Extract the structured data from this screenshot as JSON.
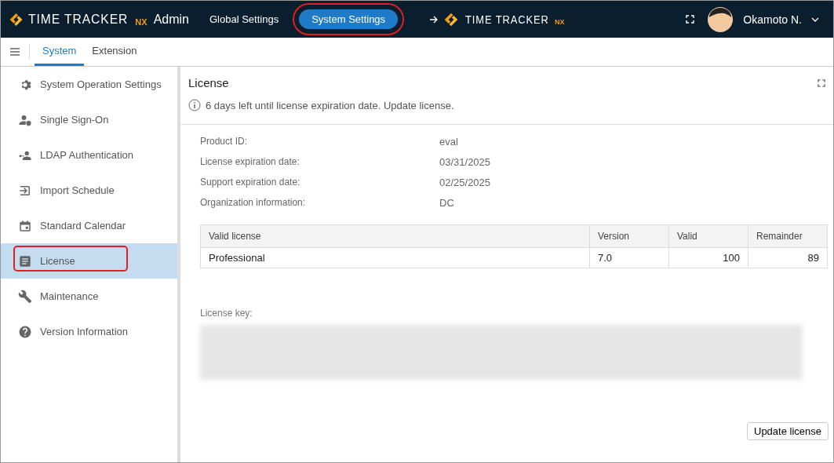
{
  "header": {
    "brand": {
      "name": "TIME TRACKER",
      "suffix": "NX",
      "label": "Admin"
    },
    "nav": [
      {
        "label": "Global Settings",
        "selected": false,
        "highlighted": false
      },
      {
        "label": "System Settings",
        "selected": true,
        "highlighted": true
      }
    ],
    "link_logo": {
      "name": "TIME TRACKER",
      "suffix": "NX"
    },
    "user": {
      "name": "Okamoto N."
    }
  },
  "tabs": [
    {
      "label": "System",
      "selected": true
    },
    {
      "label": "Extension",
      "selected": false
    }
  ],
  "sidebar": {
    "items": [
      {
        "label": "System Operation Settings",
        "selected": false,
        "highlighted": false
      },
      {
        "label": "Single Sign-On",
        "selected": false,
        "highlighted": false
      },
      {
        "label": "LDAP Authentication",
        "selected": false,
        "highlighted": false
      },
      {
        "label": "Import Schedule",
        "selected": false,
        "highlighted": false
      },
      {
        "label": "Standard Calendar",
        "selected": false,
        "highlighted": false
      },
      {
        "label": "License",
        "selected": true,
        "highlighted": true
      },
      {
        "label": "Maintenance",
        "selected": false,
        "highlighted": false
      },
      {
        "label": "Version Information",
        "selected": false,
        "highlighted": false
      }
    ]
  },
  "panel": {
    "title": "License",
    "notice": "6 days left until license expiration date. Update license.",
    "fields": [
      {
        "label": "Product ID:",
        "value": "eval"
      },
      {
        "label": "License expiration date:",
        "value": "03/31/2025"
      },
      {
        "label": "Support expiration date:",
        "value": "02/25/2025"
      },
      {
        "label": "Organization information:",
        "value": "DC"
      }
    ],
    "table": {
      "columns": [
        "Valid license",
        "Version",
        "Valid",
        "Remainder"
      ],
      "rows": [
        [
          "Professional",
          "7.0",
          "100",
          "89"
        ]
      ]
    },
    "license_key_label": "License key:",
    "button": "Update license"
  }
}
